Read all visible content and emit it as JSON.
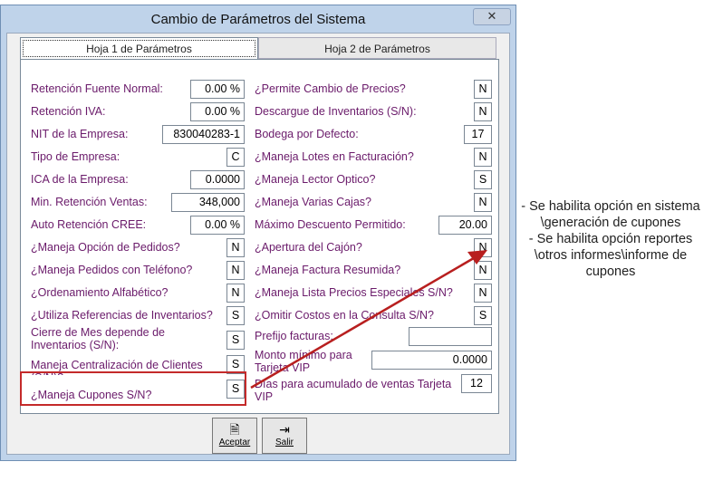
{
  "window": {
    "title": "Cambio de Parámetros del Sistema",
    "close_glyph": "✕"
  },
  "tabs": [
    {
      "label": "Hoja 1 de Parámetros"
    },
    {
      "label": "Hoja 2 de Parámetros"
    }
  ],
  "left": [
    {
      "label": "Retención Fuente Normal:",
      "value": "0.00 %"
    },
    {
      "label": "Retención IVA:",
      "value": "0.00 %"
    },
    {
      "label": "NIT de la Empresa:",
      "value": "830040283-1"
    },
    {
      "label": "Tipo de Empresa:",
      "value": "C"
    },
    {
      "label": "ICA de la Empresa:",
      "value": "0.0000"
    },
    {
      "label": "Min. Retención Ventas:",
      "value": "348,000"
    },
    {
      "label": "Auto Retención CREE:",
      "value": "0.00 %"
    },
    {
      "label": "¿Maneja Opción de Pedidos?",
      "value": "N"
    },
    {
      "label": "¿Maneja Pedidos con Teléfono?",
      "value": "N"
    },
    {
      "label": "¿Ordenamiento Alfabético?",
      "value": "N"
    },
    {
      "label": "¿Utiliza Referencias de Inventarios?",
      "value": "S"
    },
    {
      "label": "Cierre de Mes depende de Inventarios (S/N):",
      "value": "S"
    },
    {
      "label": "Maneja Centralización de Clientes (S/N)?",
      "value": "S"
    },
    {
      "label": "¿Maneja Cupones S/N?",
      "value": "S"
    }
  ],
  "right": [
    {
      "label": "¿Permite Cambio de Precios?",
      "value": "N"
    },
    {
      "label": "Descargue de Inventarios (S/N):",
      "value": "N"
    },
    {
      "label": "Bodega por Defecto:",
      "value": "17"
    },
    {
      "label": "¿Maneja Lotes en Facturación?",
      "value": "N"
    },
    {
      "label": "¿Maneja Lector Optico?",
      "value": "S"
    },
    {
      "label": "¿Maneja Varias Cajas?",
      "value": "N"
    },
    {
      "label": "Máximo Descuento Permitido:",
      "value": "20.00"
    },
    {
      "label": "¿Apertura del Cajón?",
      "value": "N"
    },
    {
      "label": "¿Maneja Factura Resumida?",
      "value": "N"
    },
    {
      "label": "¿Maneja Lista Precios Especiales S/N?",
      "value": "N"
    },
    {
      "label": "¿Omitir Costos en la Consulta S/N?",
      "value": "S"
    },
    {
      "label": "Prefijo facturas:",
      "value": ""
    },
    {
      "label": "Monto mínimo para Tarjeta VIP",
      "value": "0.0000"
    },
    {
      "label": "Días para acumulado de ventas Tarjeta VIP",
      "value": "12"
    }
  ],
  "buttons": {
    "accept": "Aceptar",
    "exit": "Salir"
  },
  "notes": {
    "note1": "- Se habilita opción en sistema\n\\generación de cupones",
    "note2": "- Se habilita opción reportes\n\\otros informes\\informe de\ncupones"
  },
  "colors": {
    "highlight_border": "#c42a2a",
    "arrow": "#b81f1f",
    "label_text": "#6a1a6a"
  }
}
